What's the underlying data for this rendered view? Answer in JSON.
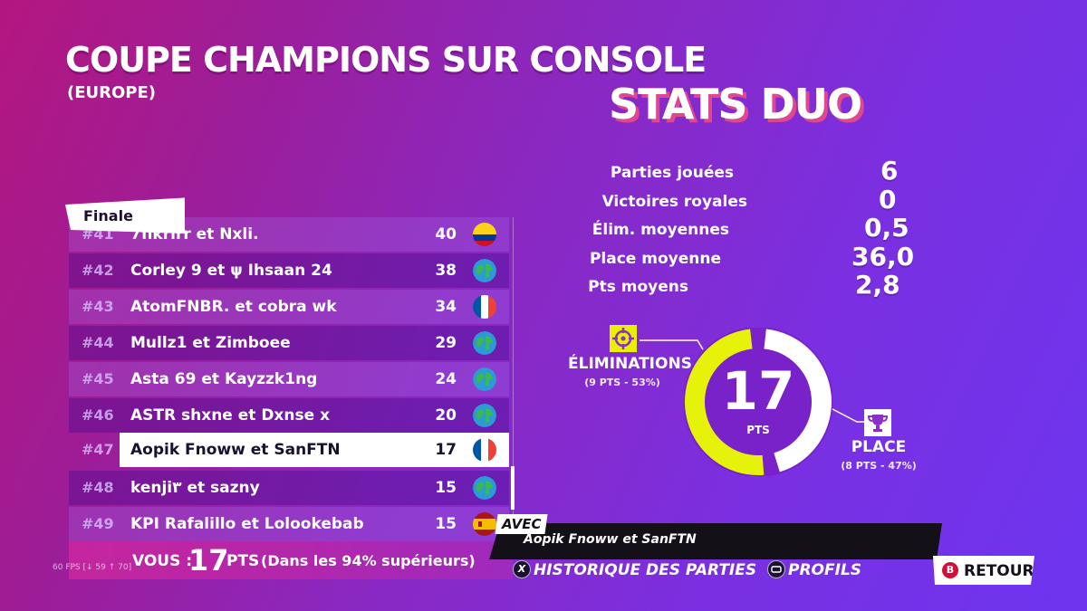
{
  "header": {
    "title": "COUPE CHAMPIONS SUR CONSOLE",
    "subtitle": "(EUROPE)",
    "stats_title": "STATS DUO"
  },
  "stats": [
    {
      "label": "Parties jouées",
      "value": "6"
    },
    {
      "label": "Victoires royales",
      "value": "0"
    },
    {
      "label": "Élim. moyennes",
      "value": "0,5"
    },
    {
      "label": "Place moyenne",
      "value": "36,0"
    },
    {
      "label": "Pts moyens",
      "value": "2,8"
    }
  ],
  "leaderboard": {
    "tab_label": "Finale",
    "rows": [
      {
        "rank": "#41",
        "name": "7fikrirr et Nxli.",
        "points": "40",
        "flag": "colombia"
      },
      {
        "rank": "#42",
        "name": "Corley 9 et ψ Ihsaan 24",
        "points": "38",
        "flag": "globe"
      },
      {
        "rank": "#43",
        "name": "AtomFNBR. et cobra wk",
        "points": "34",
        "flag": "france"
      },
      {
        "rank": "#44",
        "name": "Mullz1 et Zimboee",
        "points": "29",
        "flag": "globe"
      },
      {
        "rank": "#45",
        "name": "Asta 69 et Kayzzk1ng",
        "points": "24",
        "flag": "globe"
      },
      {
        "rank": "#46",
        "name": "ASTR shxne et Dxnse x",
        "points": "20",
        "flag": "globe"
      },
      {
        "rank": "#47",
        "name": "Aopik Fnoww et SanFTN",
        "points": "17",
        "flag": "france",
        "selected": true
      },
      {
        "rank": "#48",
        "name": "kenji٣ et sazny",
        "points": "15",
        "flag": "globe"
      },
      {
        "rank": "#49",
        "name": "KPI Rafalillo et Lolookebab",
        "points": "15",
        "flag": "spain"
      }
    ]
  },
  "you": {
    "label": "VOUS :",
    "points": "17",
    "unit": "PTS",
    "rank_text": "(Dans les 94% supérieurs)"
  },
  "fps": "60 FPS [↓ 59 ↑ 70]",
  "donut": {
    "total": "17",
    "unit": "PTS",
    "elim_label": "ÉLIMINATIONS",
    "elim_detail": "(9 PTS - 53%)",
    "elim_fraction": 0.53,
    "place_label": "PLACE",
    "place_detail": "(8 PTS - 47%)",
    "place_fraction": 0.47,
    "colors": {
      "elim": "#e6f20a",
      "place": "#ffffff"
    }
  },
  "teammate": {
    "tag": "AVEC",
    "name": "Aopik Fnoww et SanFTN"
  },
  "actions": {
    "history_key": "X",
    "history_label": "HISTORIQUE DES PARTIES",
    "profiles_label": "PROFILS",
    "back_key": "B",
    "back_label": "RETOUR"
  }
}
